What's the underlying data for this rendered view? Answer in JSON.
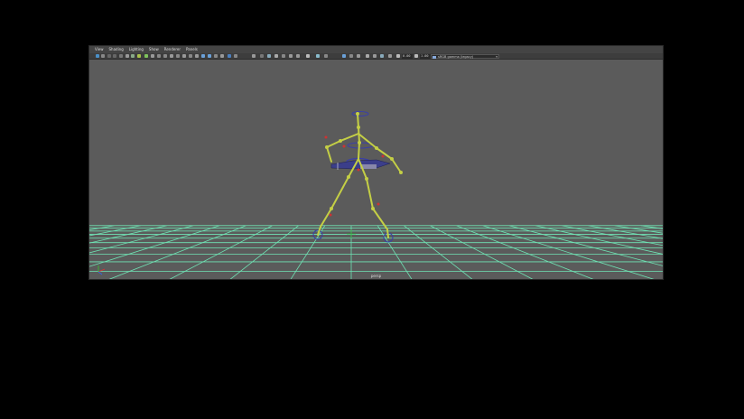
{
  "menu": [
    "View",
    "Shading",
    "Lighting",
    "Show",
    "Renderer",
    "Panels"
  ],
  "toolbar": {
    "field_value_1": "0.00",
    "field_value_2": "1.00",
    "color_space": "sRGB gamma (legacy)",
    "icons": [
      "camera-select-icon",
      "lock-camera-icon",
      "bookmark-icon",
      "image-plane-icon",
      "grid-toggle-icon",
      "film-gate-icon",
      "resolution-gate-icon",
      "safe-action-icon",
      "wireframe-icon",
      "smooth-shade-icon",
      "textured-icon",
      "lighting-icon",
      "shadows-icon",
      "screen-space-ao-icon",
      "motion-blur-icon",
      "anti-alias-icon",
      "depth-of-field-icon",
      "isolate-select-icon",
      "xray-icon",
      "xray-joints-icon",
      "backface-icon",
      "exposure-icon",
      "gamma-icon",
      "color-management-icon"
    ]
  },
  "viewport": {
    "camera_name": "persp",
    "background_color": "#5b5b5b",
    "grid_color": "#6fe3b4",
    "joint_color": "#c4cf45",
    "control_color": "#3a3fa8"
  }
}
